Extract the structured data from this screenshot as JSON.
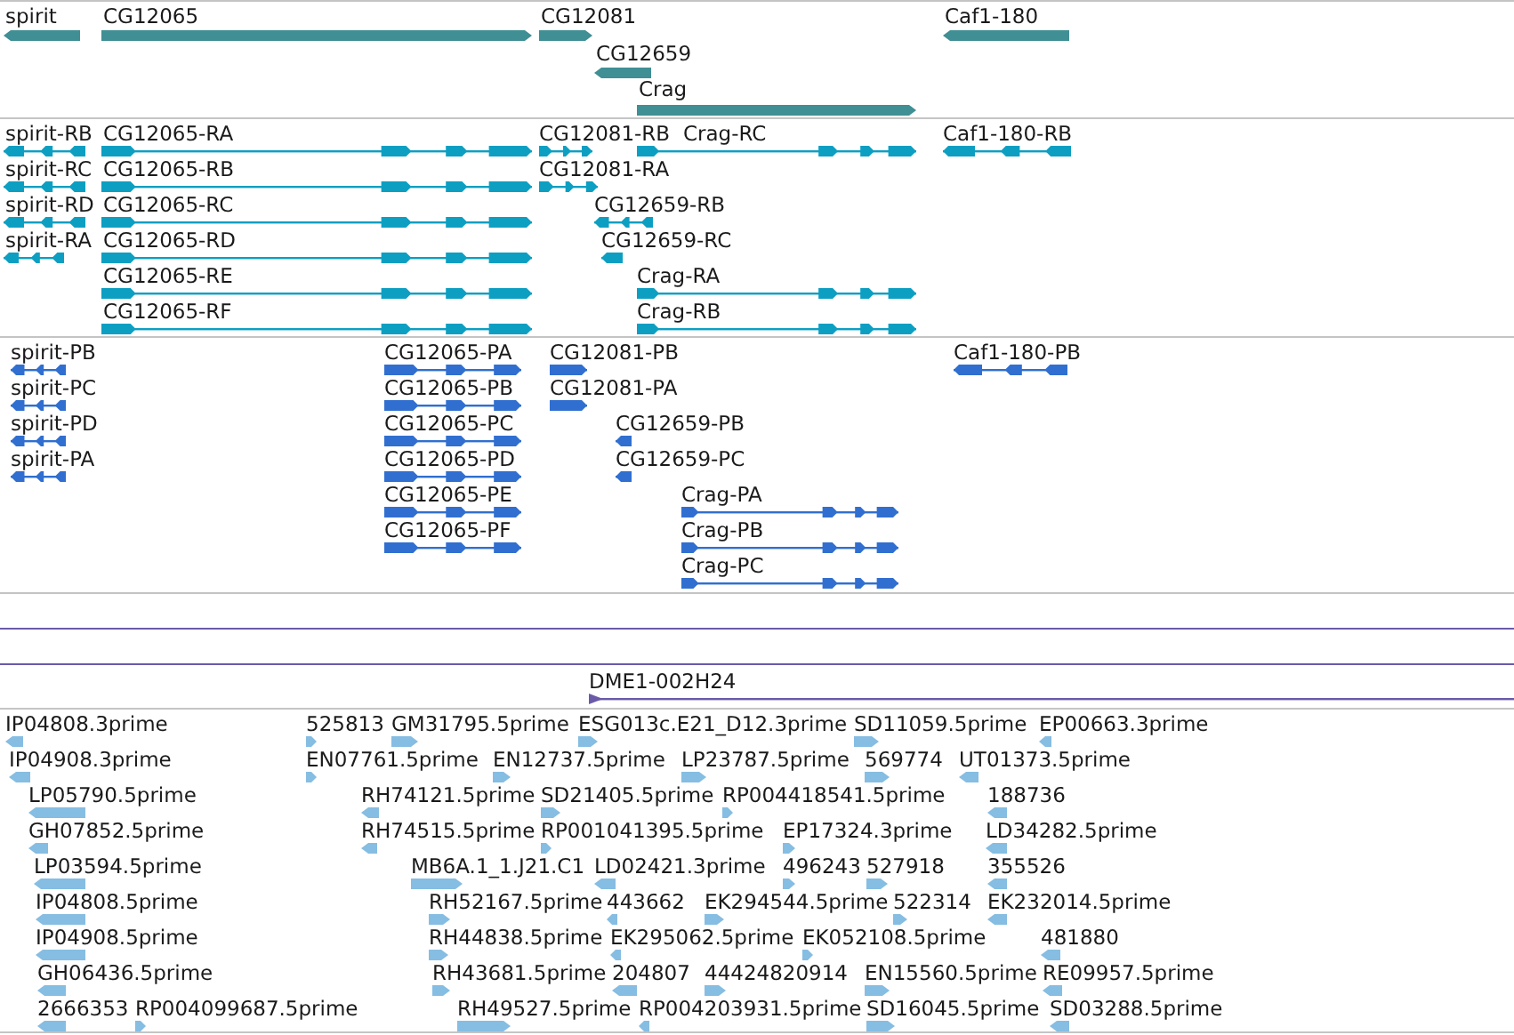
{
  "tracks": [
    {
      "kind": "gene",
      "color": "#3f8f94",
      "features": [
        {
          "label": "spirit",
          "reverse": true
        },
        {
          "label": "CG12065",
          "reverse": false
        },
        {
          "label": "CG12081",
          "reverse": false
        },
        {
          "label": "Caf1-180",
          "reverse": true
        },
        {
          "label": "CG12659",
          "reverse": true
        },
        {
          "label": "Crag",
          "reverse": false
        }
      ]
    },
    {
      "kind": "transcript",
      "color": "#0d9fc2",
      "features": [
        {
          "label": "spirit-RB",
          "reverse": true
        },
        {
          "label": "CG12065-RA",
          "reverse": false
        },
        {
          "label": "CG12081-RB",
          "reverse": false
        },
        {
          "label": "Crag-RC",
          "reverse": false
        },
        {
          "label": "Caf1-180-RB",
          "reverse": true
        },
        {
          "label": "spirit-RC",
          "reverse": true
        },
        {
          "label": "CG12065-RB",
          "reverse": false
        },
        {
          "label": "CG12081-RA",
          "reverse": false
        },
        {
          "label": "spirit-RD",
          "reverse": true
        },
        {
          "label": "CG12065-RC",
          "reverse": false
        },
        {
          "label": "CG12659-RB",
          "reverse": true
        },
        {
          "label": "spirit-RA",
          "reverse": true
        },
        {
          "label": "CG12065-RD",
          "reverse": false
        },
        {
          "label": "CG12659-RC",
          "reverse": true
        },
        {
          "label": "CG12065-RE",
          "reverse": false
        },
        {
          "label": "Crag-RA",
          "reverse": false
        },
        {
          "label": "CG12065-RF",
          "reverse": false
        },
        {
          "label": "Crag-RB",
          "reverse": false
        }
      ]
    },
    {
      "kind": "protein",
      "color": "#306fd0",
      "features": [
        {
          "label": "spirit-PB",
          "reverse": true
        },
        {
          "label": "CG12065-PA",
          "reverse": false
        },
        {
          "label": "CG12081-PB",
          "reverse": false
        },
        {
          "label": "Caf1-180-PB",
          "reverse": true
        },
        {
          "label": "spirit-PC",
          "reverse": true
        },
        {
          "label": "CG12065-PB",
          "reverse": false
        },
        {
          "label": "CG12081-PA",
          "reverse": false
        },
        {
          "label": "spirit-PD",
          "reverse": true
        },
        {
          "label": "CG12065-PC",
          "reverse": false
        },
        {
          "label": "CG12659-PB",
          "reverse": true
        },
        {
          "label": "spirit-PA",
          "reverse": true
        },
        {
          "label": "CG12065-PD",
          "reverse": false
        },
        {
          "label": "CG12659-PC",
          "reverse": true
        },
        {
          "label": "CG12065-PE",
          "reverse": false
        },
        {
          "label": "Crag-PA",
          "reverse": false
        },
        {
          "label": "CG12065-PF",
          "reverse": false
        },
        {
          "label": "Crag-PB",
          "reverse": false
        },
        {
          "label": "Crag-PC",
          "reverse": false
        }
      ]
    },
    {
      "kind": "empty",
      "color": "#6a5aa8"
    },
    {
      "kind": "clone",
      "color": "#6a5aa8",
      "features": [
        {
          "label": "DME1-002H24",
          "reverse": false
        }
      ]
    },
    {
      "kind": "est",
      "color": "#86bde2",
      "features": [
        {
          "label": "IP04808.3prime",
          "reverse": true
        },
        {
          "label": "525813",
          "reverse": false
        },
        {
          "label": "GM31795.5prime",
          "reverse": false
        },
        {
          "label": "ESG013c.E21_D12.3prime",
          "reverse": false
        },
        {
          "label": "SD11059.5prime",
          "reverse": false
        },
        {
          "label": "EP00663.3prime",
          "reverse": true
        },
        {
          "label": "IP04908.3prime",
          "reverse": true
        },
        {
          "label": "EN07761.5prime",
          "reverse": false
        },
        {
          "label": "EN12737.5prime",
          "reverse": false
        },
        {
          "label": "LP23787.5prime",
          "reverse": false
        },
        {
          "label": "569774",
          "reverse": false
        },
        {
          "label": "UT01373.5prime",
          "reverse": true
        },
        {
          "label": "LP05790.5prime",
          "reverse": true
        },
        {
          "label": "RH74121.5prime",
          "reverse": true
        },
        {
          "label": "SD21405.5prime",
          "reverse": false
        },
        {
          "label": "RP004418541.5prime",
          "reverse": false
        },
        {
          "label": "188736",
          "reverse": true
        },
        {
          "label": "GH07852.5prime",
          "reverse": true
        },
        {
          "label": "RH74515.5prime",
          "reverse": true
        },
        {
          "label": "RP001041395.5prime",
          "reverse": false
        },
        {
          "label": "EP17324.3prime",
          "reverse": false
        },
        {
          "label": "LD34282.5prime",
          "reverse": true
        },
        {
          "label": "LP03594.5prime",
          "reverse": true
        },
        {
          "label": "MB6A.1_1.J21.C1",
          "reverse": false
        },
        {
          "label": "LD02421.3prime",
          "reverse": true
        },
        {
          "label": "496243",
          "reverse": false
        },
        {
          "label": "527918",
          "reverse": false
        },
        {
          "label": "355526",
          "reverse": true
        },
        {
          "label": "IP04808.5prime",
          "reverse": true
        },
        {
          "label": "RH52167.5prime",
          "reverse": false
        },
        {
          "label": "443662",
          "reverse": true
        },
        {
          "label": "EK294544.5prime",
          "reverse": false
        },
        {
          "label": "522314",
          "reverse": false
        },
        {
          "label": "EK232014.5prime",
          "reverse": true
        },
        {
          "label": "IP04908.5prime",
          "reverse": true
        },
        {
          "label": "RH44838.5prime",
          "reverse": false
        },
        {
          "label": "EK295062.5prime",
          "reverse": true
        },
        {
          "label": "EK052108.5prime",
          "reverse": false
        },
        {
          "label": "481880",
          "reverse": true
        },
        {
          "label": "GH06436.5prime",
          "reverse": true
        },
        {
          "label": "RH43681.5prime",
          "reverse": false
        },
        {
          "label": "204807",
          "reverse": true
        },
        {
          "label": "44424820914",
          "reverse": false
        },
        {
          "label": "EN15560.5prime",
          "reverse": false
        },
        {
          "label": "RE09957.5prime",
          "reverse": true
        },
        {
          "label": "2666353",
          "reverse": true
        },
        {
          "label": "RP004099687.5prime",
          "reverse": false
        },
        {
          "label": "RH49527.5prime",
          "reverse": false
        },
        {
          "label": "RP004203931.5prime",
          "reverse": true
        },
        {
          "label": "SD16045.5prime",
          "reverse": false
        },
        {
          "label": "SD03288.5prime",
          "reverse": true
        }
      ]
    }
  ]
}
